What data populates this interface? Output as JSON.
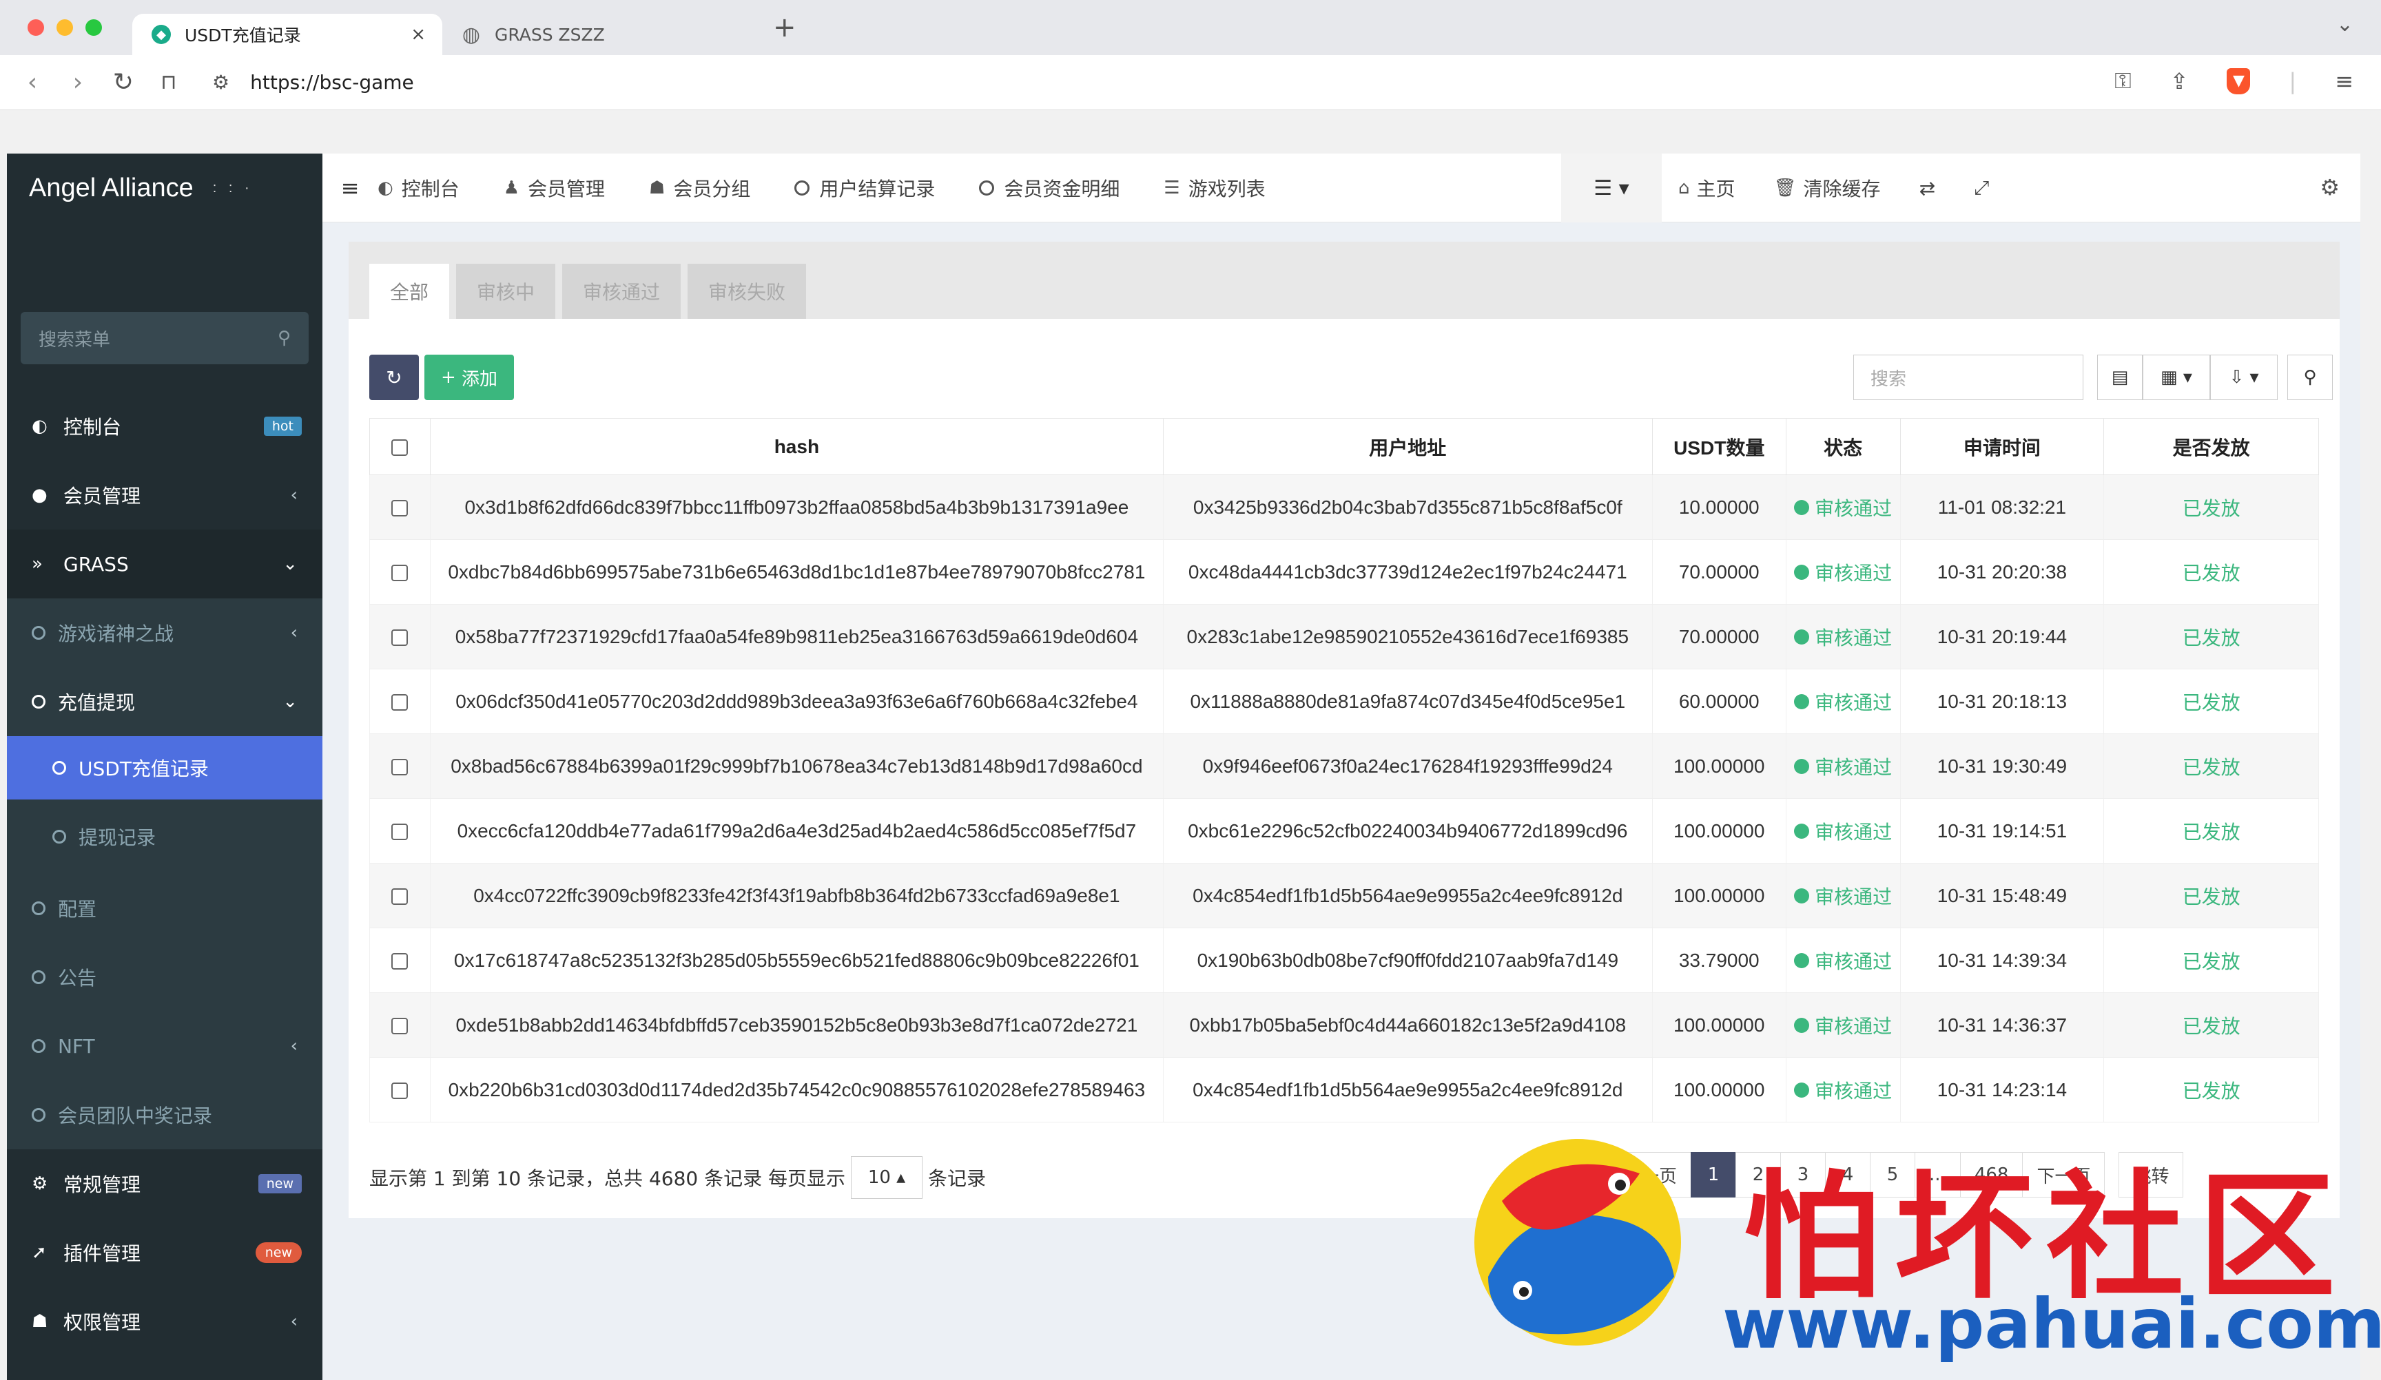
{
  "browser": {
    "tabs": [
      {
        "title": "USDT充值记录",
        "active": true
      },
      {
        "title": "GRASS ZSZZ",
        "active": false
      }
    ],
    "url": "https://bsc-game"
  },
  "brand": {
    "name": "Angel Alliance",
    "dots": ": : ·"
  },
  "sidebar": {
    "search_placeholder": "搜索菜单",
    "items": [
      {
        "label": "控制台",
        "badge": "hot"
      },
      {
        "label": "会员管理"
      },
      {
        "label": "GRASS"
      },
      {
        "label": "游戏诸神之战"
      },
      {
        "label": "充值提现"
      },
      {
        "label": "USDT充值记录"
      },
      {
        "label": "提现记录"
      },
      {
        "label": "配置"
      },
      {
        "label": "公告"
      },
      {
        "label": "NFT"
      },
      {
        "label": "会员团队中奖记录"
      },
      {
        "label": "常规管理",
        "badge": "new"
      },
      {
        "label": "插件管理",
        "badge": "new"
      },
      {
        "label": "权限管理"
      }
    ]
  },
  "topnav": {
    "items": [
      "控制台",
      "会员管理",
      "会员分组",
      "用户结算记录",
      "会员资金明细",
      "游戏列表"
    ],
    "home": "主页",
    "clear_cache": "清除缓存"
  },
  "tabs": [
    "全部",
    "审核中",
    "审核通过",
    "审核失败"
  ],
  "toolbar": {
    "add_label": "添加",
    "search_placeholder": "搜索"
  },
  "table": {
    "headers": [
      "hash",
      "用户地址",
      "USDT数量",
      "状态",
      "申请时间",
      "是否发放"
    ],
    "rows": [
      {
        "hash": "0x3d1b8f62dfd66dc839f7bbcc11ffb0973b2ffaa0858bd5a4b3b9b1317391a9ee",
        "addr": "0x3425b9336d2b04c3bab7d355c871b5c8f8af5c0f",
        "amount": "10.00000",
        "status": "审核通过",
        "time": "11-01 08:32:21",
        "issued": "已发放"
      },
      {
        "hash": "0xdbc7b84d6bb699575abe731b6e65463d8d1bc1d1e87b4ee78979070b8fcc2781",
        "addr": "0xc48da4441cb3dc37739d124e2ec1f97b24c24471",
        "amount": "70.00000",
        "status": "审核通过",
        "time": "10-31 20:20:38",
        "issued": "已发放"
      },
      {
        "hash": "0x58ba77f72371929cfd17faa0a54fe89b9811eb25ea3166763d59a6619de0d604",
        "addr": "0x283c1abe12e98590210552e43616d7ece1f69385",
        "amount": "70.00000",
        "status": "审核通过",
        "time": "10-31 20:19:44",
        "issued": "已发放"
      },
      {
        "hash": "0x06dcf350d41e05770c203d2ddd989b3deea3a93f63e6a6f760b668a4c32febe4",
        "addr": "0x11888a8880de81a9fa874c07d345e4f0d5ce95e1",
        "amount": "60.00000",
        "status": "审核通过",
        "time": "10-31 20:18:13",
        "issued": "已发放"
      },
      {
        "hash": "0x8bad56c67884b6399a01f29c999bf7b10678ea34c7eb13d8148b9d17d98a60cd",
        "addr": "0x9f946eef0673f0a24ec176284f19293fffe99d24",
        "amount": "100.00000",
        "status": "审核通过",
        "time": "10-31 19:30:49",
        "issued": "已发放"
      },
      {
        "hash": "0xecc6cfa120ddb4e77ada61f799a2d6a4e3d25ad4b2aed4c586d5cc085ef7f5d7",
        "addr": "0xbc61e2296c52cfb02240034b9406772d1899cd96",
        "amount": "100.00000",
        "status": "审核通过",
        "time": "10-31 19:14:51",
        "issued": "已发放"
      },
      {
        "hash": "0x4cc0722ffc3909cb9f8233fe42f3f43f19abfb8b364fd2b6733ccfad69a9e8e1",
        "addr": "0x4c854edf1fb1d5b564ae9e9955a2c4ee9fc8912d",
        "amount": "100.00000",
        "status": "审核通过",
        "time": "10-31 15:48:49",
        "issued": "已发放"
      },
      {
        "hash": "0x17c618747a8c5235132f3b285d05b5559ec6b521fed88806c9b09bce82226f01",
        "addr": "0x190b63b0db08be7cf90ff0fdd2107aab9fa7d149",
        "amount": "33.79000",
        "status": "审核通过",
        "time": "10-31 14:39:34",
        "issued": "已发放"
      },
      {
        "hash": "0xde51b8abb2dd14634bfdbffd57ceb3590152b5c8e0b93b3e8d7f1ca072de2721",
        "addr": "0xbb17b05ba5ebf0c4d44a660182c13e5f2a9d4108",
        "amount": "100.00000",
        "status": "审核通过",
        "time": "10-31 14:36:37",
        "issued": "已发放"
      },
      {
        "hash": "0xb220b6b31cd0303d0d1174ded2d35b74542c0c90885576102028efe278589463",
        "addr": "0x4c854edf1fb1d5b564ae9e9955a2c4ee9fc8912d",
        "amount": "100.00000",
        "status": "审核通过",
        "time": "10-31 14:23:14",
        "issued": "已发放"
      }
    ]
  },
  "footer": {
    "summary": "显示第 1 到第 10 条记录，总共 4680 条记录 每页显示",
    "page_size": "10 ▴",
    "suffix": "条记录"
  },
  "pager": {
    "pages": [
      "上一页",
      "1",
      "2",
      "3",
      "4",
      "5",
      "...",
      "468",
      "下一页"
    ],
    "jump": "跳转"
  },
  "watermark": {
    "title": "怕坏社区",
    "url": "www.pahuai.com"
  }
}
